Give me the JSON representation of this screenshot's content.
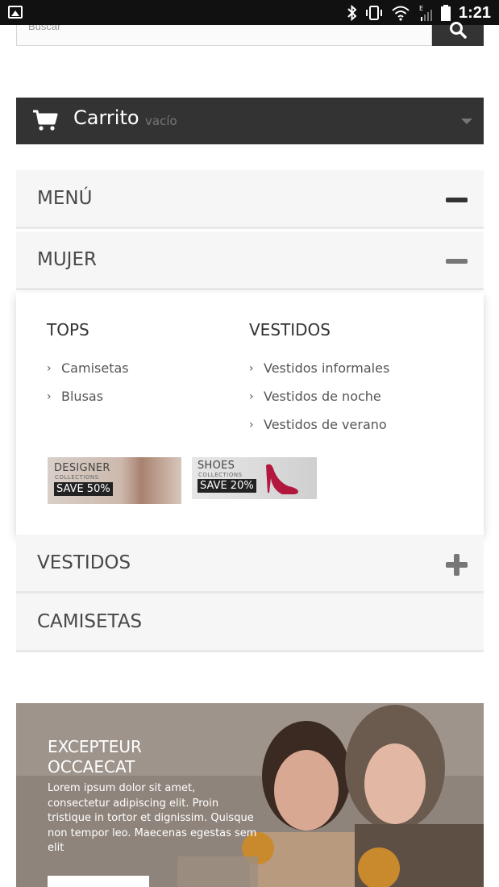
{
  "status_bar": {
    "time": "1:21",
    "icons": [
      "gallery-icon",
      "bluetooth-icon",
      "vibrate-icon",
      "wifi-icon",
      "signal-icon",
      "battery-icon"
    ]
  },
  "search": {
    "placeholder": "Buscar"
  },
  "cart": {
    "title": "Carrito",
    "status": "vacío"
  },
  "menu": {
    "menu_label": "MENÚ",
    "mujer_label": "MUJER",
    "vestidos_label": "VESTIDOS",
    "camisetas_label": "CAMISETAS"
  },
  "submenu": {
    "columns": [
      {
        "heading": "TOPS",
        "items": [
          "Camisetas",
          "Blusas"
        ]
      },
      {
        "heading": "VESTIDOS",
        "items": [
          "Vestidos informales",
          "Vestidos de noche",
          "Vestidos de verano"
        ]
      }
    ],
    "banners": [
      {
        "title": "DESIGNER",
        "sub": "COLLECTIONS",
        "tag": "SAVE 50%"
      },
      {
        "title": "SHOES",
        "sub": "COLLECTIONS",
        "tag": "SAVE 20%"
      }
    ]
  },
  "hero": {
    "title": "EXCEPTEUR OCCAECAT",
    "text": "Lorem ipsum dolor sit amet, consectetur adipiscing elit. Proin tristique in tortor et dignissim. Quisque non tempor leo. Maecenas egestas sem elit"
  },
  "colors": {
    "dark_bar": "#333333",
    "row_bg": "#f6f6f6",
    "text_dark": "#484848"
  }
}
